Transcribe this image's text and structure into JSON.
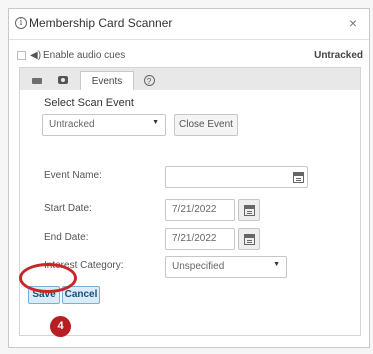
{
  "dialog": {
    "title": "Membership Card Scanner",
    "close_glyph": "×",
    "info_icon_glyph": "i"
  },
  "audio": {
    "label": "Enable audio cues",
    "status": "Untracked",
    "speaker_glyph": "◀)"
  },
  "tabs": {
    "events_label": "Events",
    "help_glyph": "?"
  },
  "scan_event": {
    "label": "Select Scan Event",
    "selected": "Untracked",
    "close_button": "Close Event"
  },
  "form": {
    "event_name_label": "Event Name:",
    "event_name_value": "",
    "start_date_label": "Start Date:",
    "start_date_value": "7/21/2022",
    "end_date_label": "End Date:",
    "end_date_value": "7/21/2022",
    "interest_label": "Interest Category:",
    "interest_value": "Unspecified"
  },
  "buttons": {
    "save": "Save",
    "cancel": "Cancel"
  },
  "annotation": {
    "step_number": "4",
    "color": "#c8262a"
  }
}
